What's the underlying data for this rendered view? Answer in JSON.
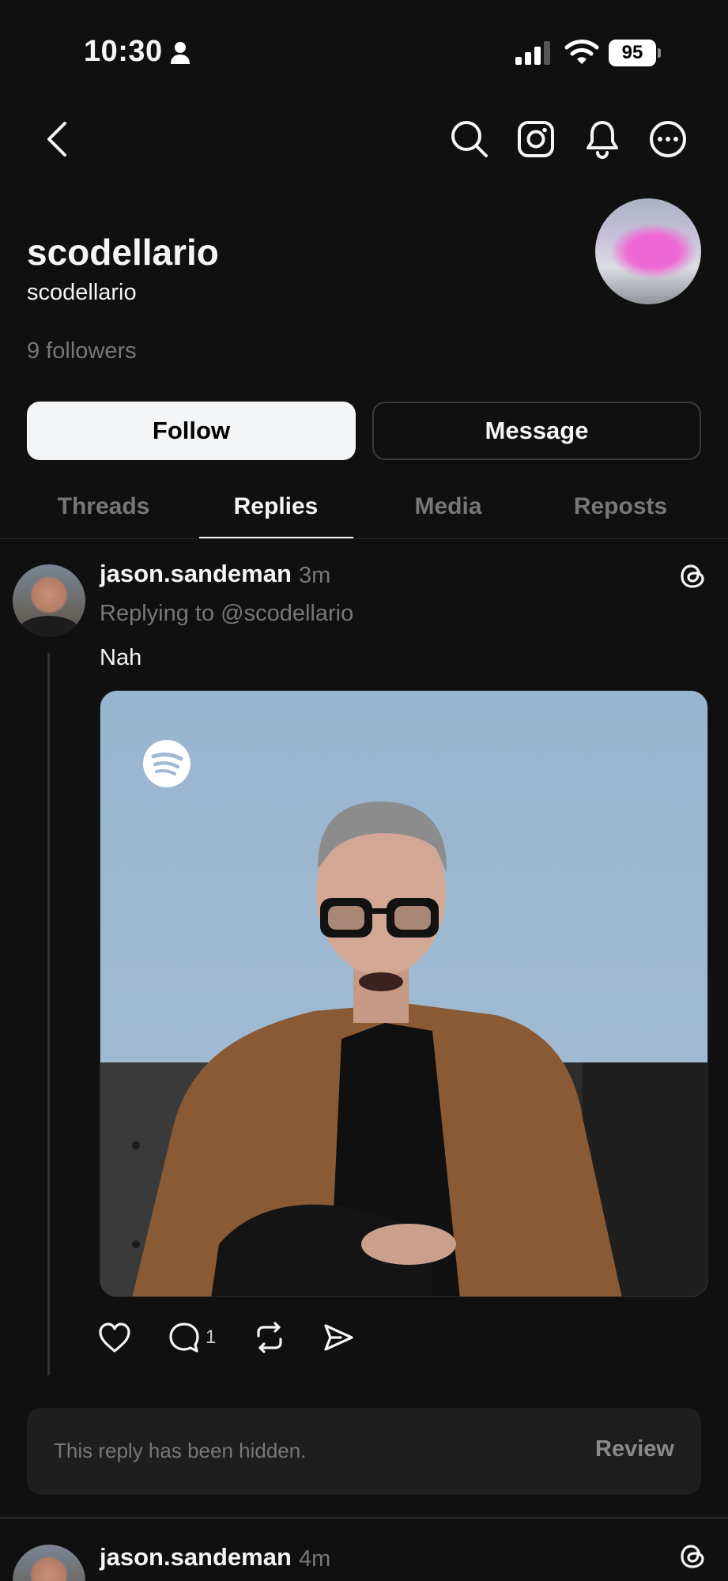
{
  "status_bar": {
    "time": "10:30",
    "battery": "95"
  },
  "nav": {
    "back_icon": "chevron-left-icon",
    "search_icon": "search-icon",
    "instagram_icon": "instagram-icon",
    "bell_icon": "bell-icon",
    "more_icon": "more-horizontal-icon"
  },
  "profile": {
    "display_name": "scodellario",
    "handle": "scodellario",
    "followers": "9 followers"
  },
  "buttons": {
    "follow": "Follow",
    "message": "Message"
  },
  "tabs": [
    {
      "label": "Threads",
      "active": false
    },
    {
      "label": "Replies",
      "active": true
    },
    {
      "label": "Media",
      "active": false
    },
    {
      "label": "Reposts",
      "active": false
    }
  ],
  "posts": [
    {
      "username": "jason.sandeman",
      "time": "3m",
      "replying_to": "Replying to @scodellario",
      "text": "Nah",
      "media_badge": "spotify-icon",
      "actions": {
        "like": "",
        "comment_count": "1",
        "repost": "",
        "share": ""
      }
    },
    {
      "username": "jason.sandeman",
      "time": "4m"
    }
  ],
  "hidden_reply": {
    "text": "This reply has been hidden.",
    "action": "Review"
  },
  "colors": {
    "background": "#101010",
    "primary_text": "#f3f5f7",
    "secondary_text": "#777777"
  }
}
